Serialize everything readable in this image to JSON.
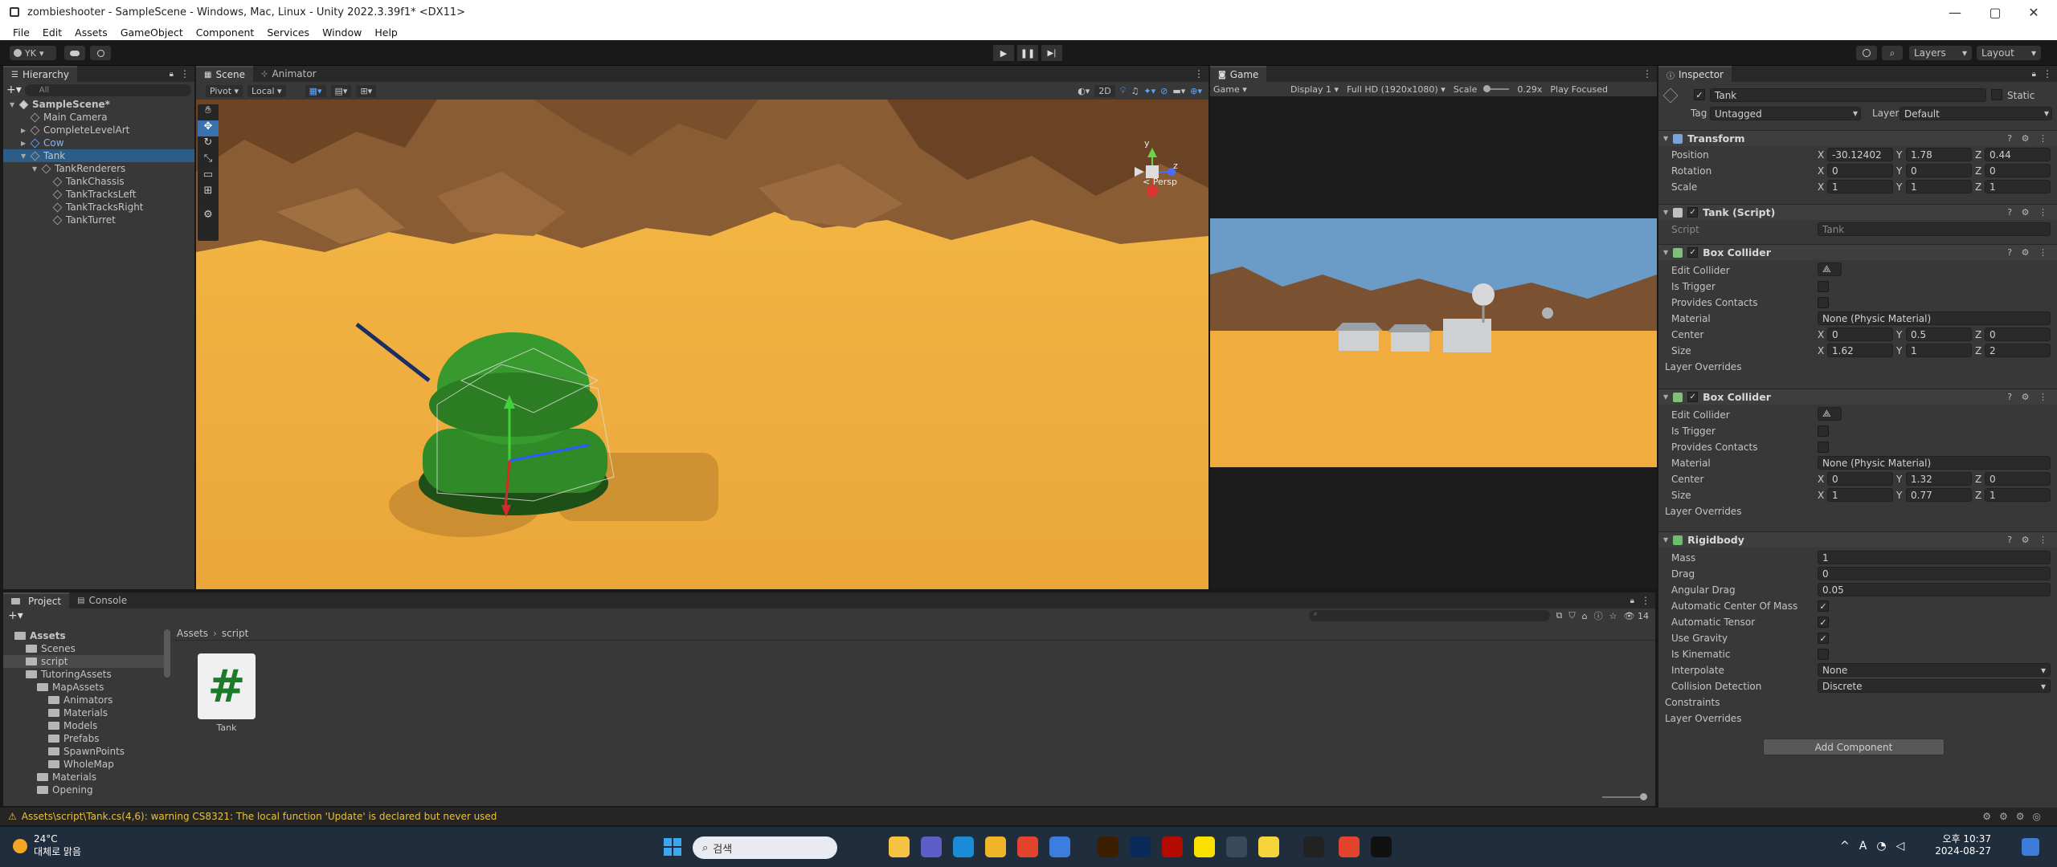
{
  "window": {
    "title": "zombieshooter - SampleScene - Windows, Mac, Linux - Unity 2022.3.39f1* <DX11>"
  },
  "menu": [
    "File",
    "Edit",
    "Assets",
    "GameObject",
    "Component",
    "Services",
    "Window",
    "Help"
  ],
  "toolbar": {
    "account": "YK",
    "layers": "Layers",
    "layout": "Layout"
  },
  "hierarchy": {
    "tab": "Hierarchy",
    "search_placeholder": "All",
    "items": [
      {
        "label": "SampleScene*",
        "depth": 0,
        "kind": "scene"
      },
      {
        "label": "Main Camera",
        "depth": 1,
        "kind": "go"
      },
      {
        "label": "CompleteLevelArt",
        "depth": 1,
        "kind": "go",
        "expandable": true
      },
      {
        "label": "Cow",
        "depth": 1,
        "kind": "prefab",
        "expandable": true
      },
      {
        "label": "Tank",
        "depth": 1,
        "kind": "go",
        "selected": true,
        "expanded": true
      },
      {
        "label": "TankRenderers",
        "depth": 2,
        "kind": "go",
        "expanded": true
      },
      {
        "label": "TankChassis",
        "depth": 3,
        "kind": "go"
      },
      {
        "label": "TankTracksLeft",
        "depth": 3,
        "kind": "go"
      },
      {
        "label": "TankTracksRight",
        "depth": 3,
        "kind": "go"
      },
      {
        "label": "TankTurret",
        "depth": 3,
        "kind": "go"
      }
    ]
  },
  "scene": {
    "tab": "Scene",
    "tab2": "Animator",
    "pivot": "Pivot",
    "local": "Local",
    "mode2d": "2D",
    "persp": "< Persp"
  },
  "game": {
    "tab": "Game",
    "view": "Game",
    "display": "Display 1",
    "resolution": "Full HD (1920x1080)",
    "scale_label": "Scale",
    "scale_value": "0.29x",
    "play_focused": "Play Focused"
  },
  "inspector": {
    "tab": "Inspector",
    "name": "Tank",
    "static": "Static",
    "tag_label": "Tag",
    "tag": "Untagged",
    "layer_label": "Layer",
    "layer": "Default",
    "transform": {
      "title": "Transform",
      "position": {
        "label": "Position",
        "x": "-30.12402",
        "y": "1.78",
        "z": "0.44"
      },
      "rotation": {
        "label": "Rotation",
        "x": "0",
        "y": "0",
        "z": "0"
      },
      "scale": {
        "label": "Scale",
        "x": "1",
        "y": "1",
        "z": "1"
      }
    },
    "tankscript": {
      "title": "Tank (Script)",
      "script_label": "Script",
      "script_value": "Tank"
    },
    "box1": {
      "title": "Box Collider",
      "edit": "Edit Collider",
      "is_trigger": "Is Trigger",
      "provides": "Provides Contacts",
      "material_label": "Material",
      "material": "None (Physic Material)",
      "center": {
        "label": "Center",
        "x": "0",
        "y": "0.5",
        "z": "0"
      },
      "size": {
        "label": "Size",
        "x": "1.62",
        "y": "1",
        "z": "2"
      },
      "overrides": "Layer Overrides"
    },
    "box2": {
      "title": "Box Collider",
      "edit": "Edit Collider",
      "is_trigger": "Is Trigger",
      "provides": "Provides Contacts",
      "material_label": "Material",
      "material": "None (Physic Material)",
      "center": {
        "label": "Center",
        "x": "0",
        "y": "1.32",
        "z": "0"
      },
      "size": {
        "label": "Size",
        "x": "1",
        "y": "0.77",
        "z": "1"
      },
      "overrides": "Layer Overrides"
    },
    "rigidbody": {
      "title": "Rigidbody",
      "mass_label": "Mass",
      "mass": "1",
      "drag_label": "Drag",
      "drag": "0",
      "angular_label": "Angular Drag",
      "angular": "0.05",
      "auto_com": "Automatic Center Of Mass",
      "auto_tensor": "Automatic Tensor",
      "gravity": "Use Gravity",
      "kinematic": "Is Kinematic",
      "interp_label": "Interpolate",
      "interp": "None",
      "collision_label": "Collision Detection",
      "collision": "Discrete",
      "constraints": "Constraints",
      "overrides": "Layer Overrides"
    },
    "add_component": "Add Component"
  },
  "project": {
    "tab": "Project",
    "tab2": "Console",
    "count": "14",
    "breadcrumb": [
      "Assets",
      "script"
    ],
    "asset": "Tank",
    "tree": [
      {
        "label": "Assets",
        "depth": 0,
        "bold": true
      },
      {
        "label": "Scenes",
        "depth": 1
      },
      {
        "label": "script",
        "depth": 1,
        "selected": true
      },
      {
        "label": "TutoringAssets",
        "depth": 1
      },
      {
        "label": "MapAssets",
        "depth": 2
      },
      {
        "label": "Animators",
        "depth": 3
      },
      {
        "label": "Materials",
        "depth": 3
      },
      {
        "label": "Models",
        "depth": 3
      },
      {
        "label": "Prefabs",
        "depth": 3
      },
      {
        "label": "SpawnPoints",
        "depth": 3
      },
      {
        "label": "WholeMap",
        "depth": 3
      },
      {
        "label": "Materials",
        "depth": 2
      },
      {
        "label": "Opening",
        "depth": 2
      }
    ]
  },
  "status": {
    "warning": "Assets\\script\\Tank.cs(4,6): warning CS8321: The local function 'Update' is declared but never used"
  },
  "taskbar": {
    "temp": "24°C",
    "weather": "대체로 맑음",
    "search": "검색",
    "time": "오후 10:37",
    "date": "2024-08-27",
    "lang": "A"
  },
  "colors": {
    "accent": "#2c5d87",
    "sand": "#f0b244",
    "tank": "#2e8a26"
  }
}
